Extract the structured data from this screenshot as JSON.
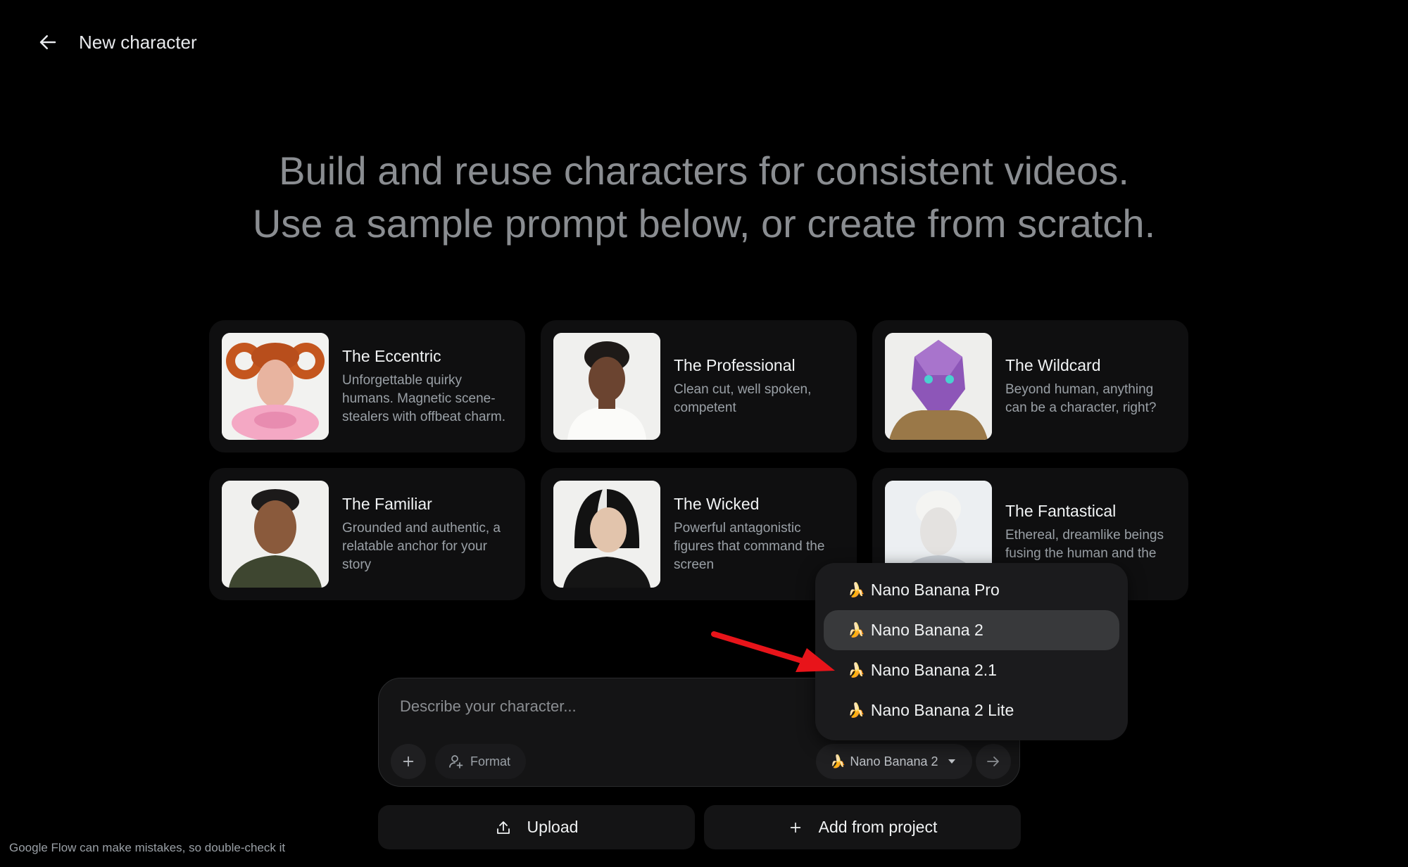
{
  "header": {
    "title": "New character"
  },
  "hero": {
    "line1": "Build and reuse characters for consistent videos.",
    "line2": "Use a sample prompt below, or create from scratch."
  },
  "cards": [
    {
      "title": "The Eccentric",
      "desc": "Unforgettable quirky humans. Magnetic scene-stealers with offbeat charm."
    },
    {
      "title": "The Professional",
      "desc": "Clean cut, well spoken, competent"
    },
    {
      "title": "The Wildcard",
      "desc": "Beyond human, anything can be a character, right?"
    },
    {
      "title": "The Familiar",
      "desc": "Grounded and authentic, a relatable anchor for your story"
    },
    {
      "title": "The Wicked",
      "desc": "Powerful antagonistic figures that command the screen"
    },
    {
      "title": "The Fantastical",
      "desc": "Ethereal, dreamlike beings fusing the human and the mythical"
    }
  ],
  "prompt": {
    "placeholder": "Describe your character...",
    "format_label": "Format",
    "model_emoji": "🍌",
    "model_label": "Nano Banana 2"
  },
  "dropdown": {
    "items": [
      {
        "emoji": "🍌",
        "label": "Nano Banana Pro"
      },
      {
        "emoji": "🍌",
        "label": "Nano Banana 2",
        "selected": true
      },
      {
        "emoji": "🍌",
        "label": "Nano Banana 2.1"
      },
      {
        "emoji": "🍌",
        "label": "Nano Banana 2 Lite"
      }
    ]
  },
  "buttons": {
    "upload": "Upload",
    "add_from_project": "Add from project"
  },
  "disclaimer": "Google Flow can make mistakes, so double-check it",
  "colors": {
    "background": "#000000",
    "card": "#0f0f10",
    "arrow": "#e8141a",
    "selected_item": "#38393b"
  },
  "icons": [
    "back-arrow-icon",
    "plus-icon",
    "person-add-icon",
    "caret-down-icon",
    "arrow-right-icon",
    "upload-icon",
    "banana-icon"
  ]
}
